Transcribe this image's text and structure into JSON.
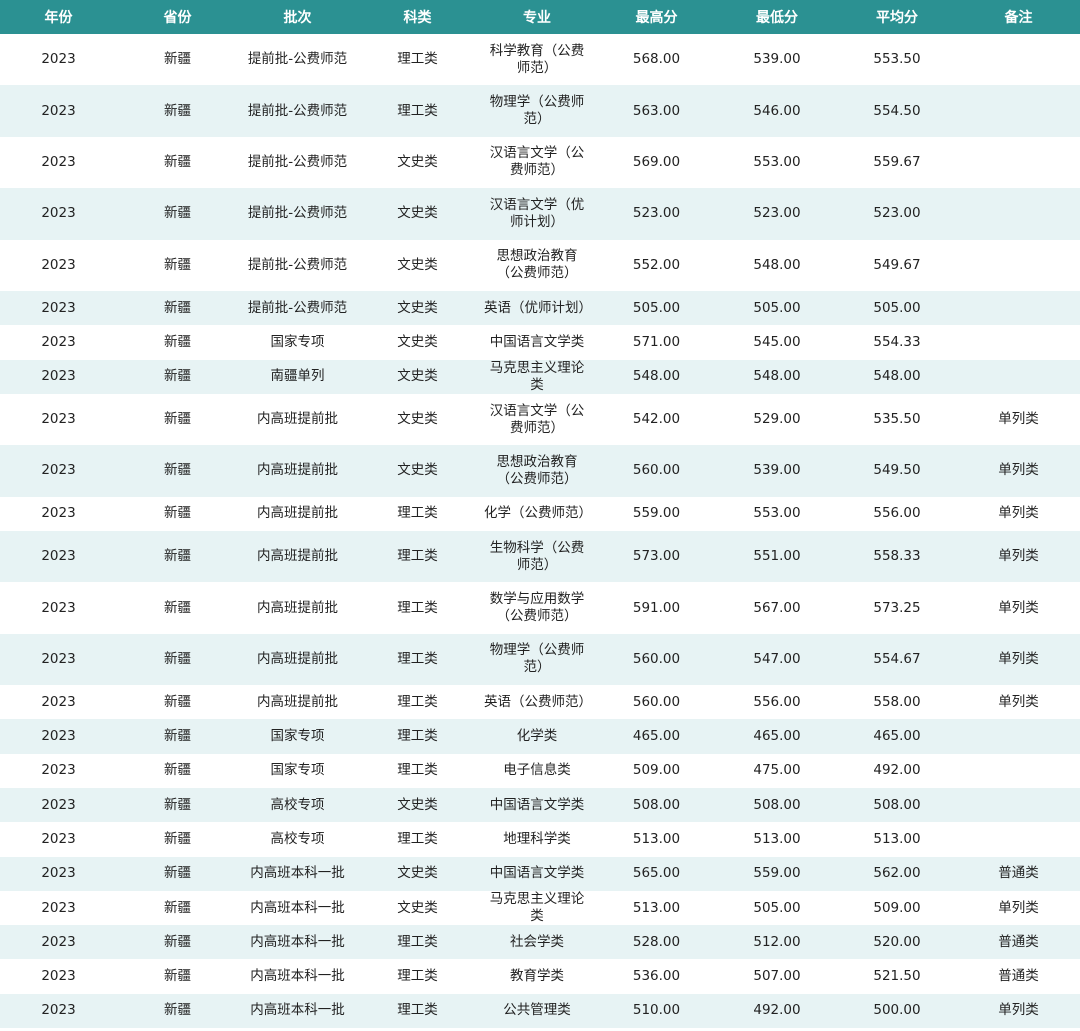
{
  "headers": [
    "年份",
    "省份",
    "批次",
    "科类",
    "专业",
    "最高分",
    "最低分",
    "平均分",
    "备注"
  ],
  "rows": [
    {
      "year": "2023",
      "province": "新疆",
      "batch": "提前批-公费师范",
      "category": "理工类",
      "major": "科学教育（公费师范）",
      "max": "568.00",
      "min": "539.00",
      "avg": "553.50",
      "note": ""
    },
    {
      "year": "2023",
      "province": "新疆",
      "batch": "提前批-公费师范",
      "category": "理工类",
      "major": "物理学（公费师范）",
      "max": "563.00",
      "min": "546.00",
      "avg": "554.50",
      "note": ""
    },
    {
      "year": "2023",
      "province": "新疆",
      "batch": "提前批-公费师范",
      "category": "文史类",
      "major": "汉语言文学（公费师范）",
      "max": "569.00",
      "min": "553.00",
      "avg": "559.67",
      "note": ""
    },
    {
      "year": "2023",
      "province": "新疆",
      "batch": "提前批-公费师范",
      "category": "文史类",
      "major": "汉语言文学（优师计划）",
      "max": "523.00",
      "min": "523.00",
      "avg": "523.00",
      "note": ""
    },
    {
      "year": "2023",
      "province": "新疆",
      "batch": "提前批-公费师范",
      "category": "文史类",
      "major": "思想政治教育（公费师范）",
      "max": "552.00",
      "min": "548.00",
      "avg": "549.67",
      "note": ""
    },
    {
      "year": "2023",
      "province": "新疆",
      "batch": "提前批-公费师范",
      "category": "文史类",
      "major": "英语（优师计划）",
      "max": "505.00",
      "min": "505.00",
      "avg": "505.00",
      "note": ""
    },
    {
      "year": "2023",
      "province": "新疆",
      "batch": "国家专项",
      "category": "文史类",
      "major": "中国语言文学类",
      "max": "571.00",
      "min": "545.00",
      "avg": "554.33",
      "note": ""
    },
    {
      "year": "2023",
      "province": "新疆",
      "batch": "南疆单列",
      "category": "文史类",
      "major": "马克思主义理论类",
      "max": "548.00",
      "min": "548.00",
      "avg": "548.00",
      "note": ""
    },
    {
      "year": "2023",
      "province": "新疆",
      "batch": "内高班提前批",
      "category": "文史类",
      "major": "汉语言文学（公费师范）",
      "max": "542.00",
      "min": "529.00",
      "avg": "535.50",
      "note": "单列类"
    },
    {
      "year": "2023",
      "province": "新疆",
      "batch": "内高班提前批",
      "category": "文史类",
      "major": "思想政治教育（公费师范）",
      "max": "560.00",
      "min": "539.00",
      "avg": "549.50",
      "note": "单列类"
    },
    {
      "year": "2023",
      "province": "新疆",
      "batch": "内高班提前批",
      "category": "理工类",
      "major": "化学（公费师范）",
      "max": "559.00",
      "min": "553.00",
      "avg": "556.00",
      "note": "单列类"
    },
    {
      "year": "2023",
      "province": "新疆",
      "batch": "内高班提前批",
      "category": "理工类",
      "major": "生物科学（公费师范）",
      "max": "573.00",
      "min": "551.00",
      "avg": "558.33",
      "note": "单列类"
    },
    {
      "year": "2023",
      "province": "新疆",
      "batch": "内高班提前批",
      "category": "理工类",
      "major": "数学与应用数学（公费师范）",
      "max": "591.00",
      "min": "567.00",
      "avg": "573.25",
      "note": "单列类"
    },
    {
      "year": "2023",
      "province": "新疆",
      "batch": "内高班提前批",
      "category": "理工类",
      "major": "物理学（公费师范）",
      "max": "560.00",
      "min": "547.00",
      "avg": "554.67",
      "note": "单列类"
    },
    {
      "year": "2023",
      "province": "新疆",
      "batch": "内高班提前批",
      "category": "理工类",
      "major": "英语（公费师范）",
      "max": "560.00",
      "min": "556.00",
      "avg": "558.00",
      "note": "单列类"
    },
    {
      "year": "2023",
      "province": "新疆",
      "batch": "国家专项",
      "category": "理工类",
      "major": "化学类",
      "max": "465.00",
      "min": "465.00",
      "avg": "465.00",
      "note": ""
    },
    {
      "year": "2023",
      "province": "新疆",
      "batch": "国家专项",
      "category": "理工类",
      "major": "电子信息类",
      "max": "509.00",
      "min": "475.00",
      "avg": "492.00",
      "note": ""
    },
    {
      "year": "2023",
      "province": "新疆",
      "batch": "高校专项",
      "category": "文史类",
      "major": "中国语言文学类",
      "max": "508.00",
      "min": "508.00",
      "avg": "508.00",
      "note": ""
    },
    {
      "year": "2023",
      "province": "新疆",
      "batch": "高校专项",
      "category": "理工类",
      "major": "地理科学类",
      "max": "513.00",
      "min": "513.00",
      "avg": "513.00",
      "note": ""
    },
    {
      "year": "2023",
      "province": "新疆",
      "batch": "内高班本科一批",
      "category": "文史类",
      "major": "中国语言文学类",
      "max": "565.00",
      "min": "559.00",
      "avg": "562.00",
      "note": "普通类"
    },
    {
      "year": "2023",
      "province": "新疆",
      "batch": "内高班本科一批",
      "category": "文史类",
      "major": "马克思主义理论类",
      "max": "513.00",
      "min": "505.00",
      "avg": "509.00",
      "note": "单列类"
    },
    {
      "year": "2023",
      "province": "新疆",
      "batch": "内高班本科一批",
      "category": "理工类",
      "major": "社会学类",
      "max": "528.00",
      "min": "512.00",
      "avg": "520.00",
      "note": "普通类"
    },
    {
      "year": "2023",
      "province": "新疆",
      "batch": "内高班本科一批",
      "category": "理工类",
      "major": "教育学类",
      "max": "536.00",
      "min": "507.00",
      "avg": "521.50",
      "note": "普通类"
    },
    {
      "year": "2023",
      "province": "新疆",
      "batch": "内高班本科一批",
      "category": "理工类",
      "major": "公共管理类",
      "max": "510.00",
      "min": "492.00",
      "avg": "500.00",
      "note": "单列类"
    }
  ],
  "colors": {
    "header_bg": "#2b9192",
    "stripe": "#e7f3f4"
  }
}
